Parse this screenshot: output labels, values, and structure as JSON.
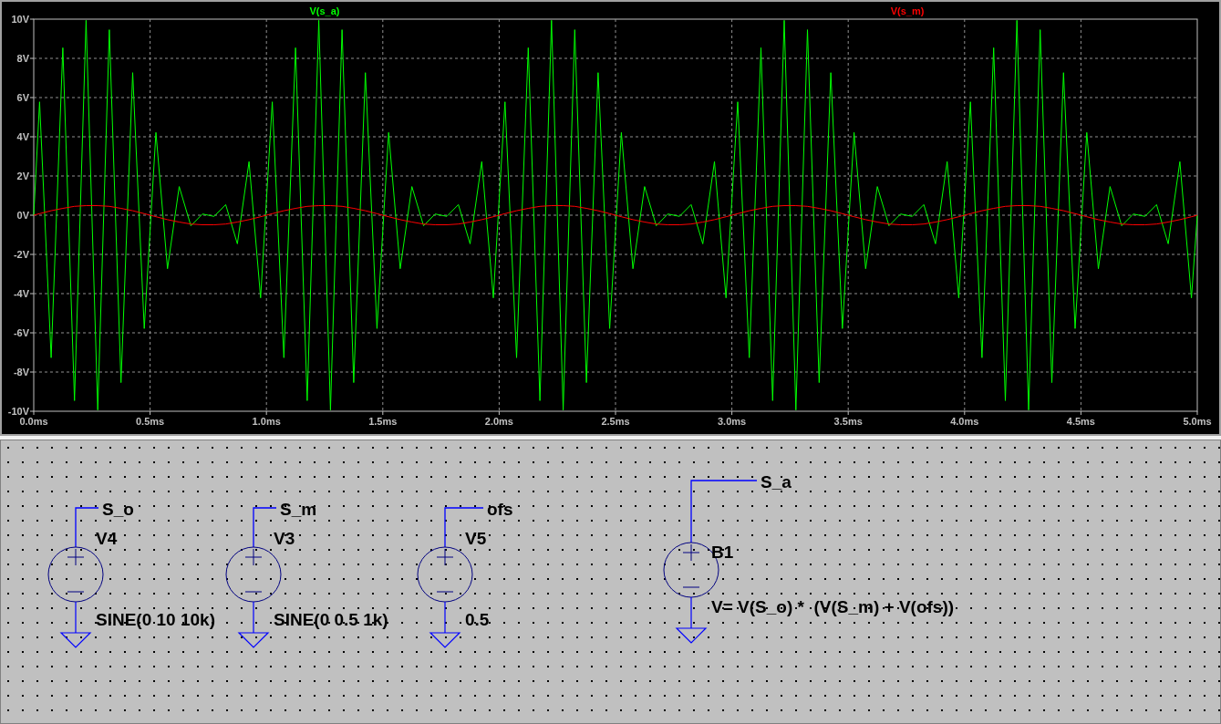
{
  "plot": {
    "chart_data": {
      "type": "line",
      "grid": true,
      "xlim": [
        0,
        5
      ],
      "ylim": [
        -10,
        10
      ],
      "xticks": [
        {
          "value": 0,
          "label": "0.0ms"
        },
        {
          "value": 0.5,
          "label": "0.5ms"
        },
        {
          "value": 1,
          "label": "1.0ms"
        },
        {
          "value": 1.5,
          "label": "1.5ms"
        },
        {
          "value": 2,
          "label": "2.0ms"
        },
        {
          "value": 2.5,
          "label": "2.5ms"
        },
        {
          "value": 3,
          "label": "3.0ms"
        },
        {
          "value": 3.5,
          "label": "3.5ms"
        },
        {
          "value": 4,
          "label": "4.0ms"
        },
        {
          "value": 4.5,
          "label": "4.5ms"
        },
        {
          "value": 5,
          "label": "5.0ms"
        }
      ],
      "yticks": [
        {
          "value": 10,
          "label": "10V"
        },
        {
          "value": 8,
          "label": "8V"
        },
        {
          "value": 6,
          "label": "6V"
        },
        {
          "value": 4,
          "label": "4V"
        },
        {
          "value": 2,
          "label": "2V"
        },
        {
          "value": 0,
          "label": "0V"
        },
        {
          "value": -2,
          "label": "-2V"
        },
        {
          "value": -4,
          "label": "-4V"
        },
        {
          "value": -6,
          "label": "-6V"
        },
        {
          "value": -8,
          "label": "-8V"
        },
        {
          "value": -10,
          "label": "-10V"
        }
      ],
      "x": [
        0,
        0.025,
        0.075,
        0.125,
        0.175,
        0.225,
        0.275,
        0.325,
        0.375,
        0.425,
        0.475,
        0.525,
        0.575,
        0.625,
        0.675,
        0.725,
        0.775,
        0.825,
        0.875,
        0.925,
        0.975,
        1.025,
        1.075,
        1.125,
        1.175,
        1.225,
        1.275,
        1.325,
        1.375,
        1.425,
        1.475,
        1.525,
        1.575,
        1.625,
        1.675,
        1.725,
        1.775,
        1.825,
        1.875,
        1.925,
        1.975,
        2.025,
        2.075,
        2.125,
        2.175,
        2.225,
        2.275,
        2.325,
        2.375,
        2.425,
        2.475,
        2.525,
        2.575,
        2.625,
        2.675,
        2.725,
        2.775,
        2.825,
        2.875,
        2.925,
        2.975,
        3.025,
        3.075,
        3.125,
        3.175,
        3.225,
        3.275,
        3.325,
        3.375,
        3.425,
        3.475,
        3.525,
        3.575,
        3.625,
        3.675,
        3.725,
        3.775,
        3.825,
        3.875,
        3.925,
        3.975,
        4.025,
        4.075,
        4.125,
        4.175,
        4.225,
        4.275,
        4.325,
        4.375,
        4.425,
        4.475,
        4.525,
        4.575,
        4.625,
        4.675,
        4.725,
        4.775,
        4.825,
        4.875,
        4.925,
        4.975,
        5
      ],
      "series": [
        {
          "name": "V(s_a)",
          "color": "#00ff00",
          "values": [
            0,
            5.78,
            -7.27,
            8.54,
            -9.46,
            9.94,
            -9.94,
            9.46,
            -8.54,
            7.27,
            -5.78,
            4.22,
            -2.73,
            1.46,
            -0.54,
            0.06,
            -0.06,
            0.54,
            -1.46,
            2.73,
            -4.22,
            5.78,
            -7.27,
            8.54,
            -9.46,
            9.94,
            -9.94,
            9.46,
            -8.54,
            7.27,
            -5.78,
            4.22,
            -2.73,
            1.46,
            -0.54,
            0.06,
            -0.06,
            0.54,
            -1.46,
            2.73,
            -4.22,
            5.78,
            -7.27,
            8.54,
            -9.46,
            9.94,
            -9.94,
            9.46,
            -8.54,
            7.27,
            -5.78,
            4.22,
            -2.73,
            1.46,
            -0.54,
            0.06,
            -0.06,
            0.54,
            -1.46,
            2.73,
            -4.22,
            5.78,
            -7.27,
            8.54,
            -9.46,
            9.94,
            -9.94,
            9.46,
            -8.54,
            7.27,
            -5.78,
            4.22,
            -2.73,
            1.46,
            -0.54,
            0.06,
            -0.06,
            0.54,
            -1.46,
            2.73,
            -4.22,
            5.78,
            -7.27,
            8.54,
            -9.46,
            9.94,
            -9.94,
            9.46,
            -8.54,
            7.27,
            -5.78,
            4.22,
            -2.73,
            1.46,
            -0.54,
            0.06,
            -0.06,
            0.54,
            -1.46,
            2.73,
            -4.22,
            0
          ]
        },
        {
          "name": "V(s_m)",
          "color": "#ff0000",
          "values": [
            0,
            0.08,
            0.23,
            0.35,
            0.45,
            0.49,
            0.49,
            0.45,
            0.35,
            0.23,
            0.08,
            -0.08,
            -0.23,
            -0.35,
            -0.45,
            -0.49,
            -0.49,
            -0.45,
            -0.35,
            -0.23,
            -0.08,
            0.08,
            0.23,
            0.35,
            0.45,
            0.49,
            0.49,
            0.45,
            0.35,
            0.23,
            0.08,
            -0.08,
            -0.23,
            -0.35,
            -0.45,
            -0.49,
            -0.49,
            -0.45,
            -0.35,
            -0.23,
            -0.08,
            0.08,
            0.23,
            0.35,
            0.45,
            0.49,
            0.49,
            0.45,
            0.35,
            0.23,
            0.08,
            -0.08,
            -0.23,
            -0.35,
            -0.45,
            -0.49,
            -0.49,
            -0.45,
            -0.35,
            -0.23,
            -0.08,
            0.08,
            0.23,
            0.35,
            0.45,
            0.49,
            0.49,
            0.45,
            0.35,
            0.23,
            0.08,
            -0.08,
            -0.23,
            -0.35,
            -0.45,
            -0.49,
            -0.49,
            -0.45,
            -0.35,
            -0.23,
            -0.08,
            0.08,
            0.23,
            0.35,
            0.45,
            0.49,
            0.49,
            0.45,
            0.35,
            0.23,
            0.08,
            -0.08,
            -0.23,
            -0.35,
            -0.45,
            -0.49,
            -0.49,
            -0.45,
            -0.35,
            -0.23,
            -0.08,
            0
          ]
        }
      ]
    }
  },
  "schematic": {
    "components": [
      {
        "name": "V4",
        "net_label": "S_o",
        "value": "SINE(0 10 10k)"
      },
      {
        "name": "V3",
        "net_label": "S_m",
        "value": "SINE(0 0.5 1k)"
      },
      {
        "name": "V5",
        "net_label": "ofs",
        "value": "0.5"
      },
      {
        "name": "B1",
        "net_label": "S_a",
        "value": "V= V(S_o) *  (V(S_m) + V(ofs))"
      }
    ]
  }
}
